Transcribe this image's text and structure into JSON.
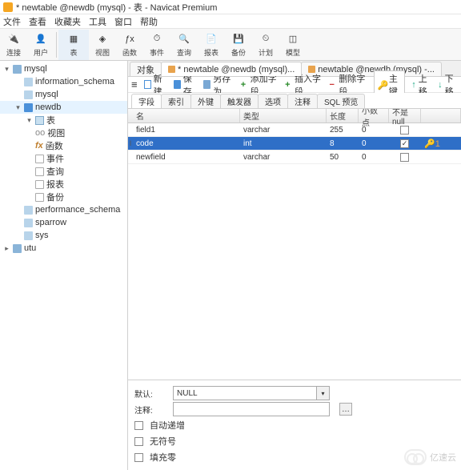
{
  "window": {
    "title": "* newtable @newdb (mysql) - 表 - Navicat Premium"
  },
  "menu": [
    "文件",
    "查看",
    "收藏夹",
    "工具",
    "窗口",
    "帮助"
  ],
  "toolbar": [
    {
      "label": "连接",
      "icon": "plug"
    },
    {
      "label": "用户",
      "icon": "user"
    },
    {
      "sep": true
    },
    {
      "label": "表",
      "icon": "table",
      "active": true
    },
    {
      "label": "视图",
      "icon": "view"
    },
    {
      "label": "函数",
      "icon": "fn"
    },
    {
      "label": "事件",
      "icon": "event"
    },
    {
      "label": "查询",
      "icon": "query"
    },
    {
      "label": "报表",
      "icon": "report"
    },
    {
      "label": "备份",
      "icon": "backup"
    },
    {
      "label": "计划",
      "icon": "schedule"
    },
    {
      "label": "模型",
      "icon": "model"
    }
  ],
  "tree": [
    {
      "label": "mysql",
      "type": "conn",
      "expand": "open",
      "depth": 0
    },
    {
      "label": "information_schema",
      "type": "db-lite",
      "depth": 1
    },
    {
      "label": "mysql",
      "type": "db-lite",
      "depth": 1
    },
    {
      "label": "newdb",
      "type": "db",
      "expand": "open",
      "depth": 1,
      "sel": true
    },
    {
      "label": "表",
      "type": "tbl",
      "expand": "open",
      "depth": 2
    },
    {
      "label": "视图",
      "type": "item",
      "icon": "oo",
      "depth": 2
    },
    {
      "label": "函数",
      "type": "item",
      "icon": "fn",
      "depth": 2
    },
    {
      "label": "事件",
      "type": "item",
      "icon": "ev",
      "depth": 2
    },
    {
      "label": "查询",
      "type": "item",
      "icon": "qr",
      "depth": 2
    },
    {
      "label": "报表",
      "type": "item",
      "icon": "rp",
      "depth": 2
    },
    {
      "label": "备份",
      "type": "item",
      "icon": "bk",
      "depth": 2
    },
    {
      "label": "performance_schema",
      "type": "db-lite",
      "depth": 1
    },
    {
      "label": "sparrow",
      "type": "db-lite",
      "depth": 1
    },
    {
      "label": "sys",
      "type": "db-lite",
      "depth": 1
    },
    {
      "label": "utu",
      "type": "conn",
      "expand": "closed",
      "depth": 0
    }
  ],
  "tabs": [
    {
      "label": "对象"
    },
    {
      "label": "* newtable @newdb (mysql)...",
      "active": true
    },
    {
      "label": "newtable @newdb (mysql) -..."
    }
  ],
  "actions": {
    "menu": "≡",
    "new": "新建",
    "save": "保存",
    "saveas": "另存为",
    "addfield": "添加字段",
    "insertfield": "插入字段",
    "delfield": "删除字段",
    "primarykey": "主键",
    "moveup": "上移",
    "movedown": "下移"
  },
  "subtabs": [
    "字段",
    "索引",
    "外键",
    "触发器",
    "选项",
    "注释",
    "SQL 预览"
  ],
  "columns": {
    "name": "名",
    "type": "类型",
    "length": "长度",
    "decimals": "小数点",
    "notnull": "不是 null"
  },
  "rows": [
    {
      "name": "field1",
      "type": "varchar",
      "length": "255",
      "decimals": "0",
      "notnull": false,
      "pk": false,
      "sel": false
    },
    {
      "name": "code",
      "type": "int",
      "length": "8",
      "decimals": "0",
      "notnull": true,
      "pk": true,
      "keylabel": "1",
      "sel": true,
      "editing": true
    },
    {
      "name": "newfield",
      "type": "varchar",
      "length": "50",
      "decimals": "0",
      "notnull": false,
      "pk": false,
      "sel": false
    }
  ],
  "bottom": {
    "default_lbl": "默认:",
    "default_val": "NULL",
    "comment_lbl": "注释:",
    "auto_incr": "自动递增",
    "unsigned": "无符号",
    "zerofill": "填充零"
  },
  "watermark": "亿速云"
}
